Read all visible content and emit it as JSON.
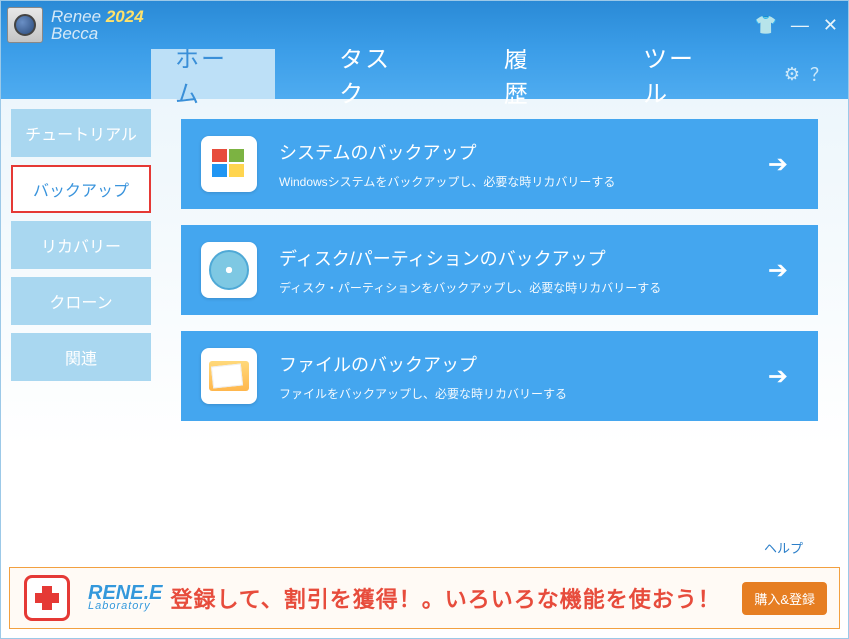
{
  "brand": {
    "name1": "Renee",
    "name2": "Becca",
    "year": "2024"
  },
  "title_controls": {
    "pin_icon": "pin-icon",
    "min_icon": "minimize-icon",
    "close_icon": "close-icon"
  },
  "nav": {
    "tabs": [
      {
        "label": "ホーム",
        "active": true
      },
      {
        "label": "タスク",
        "active": false
      },
      {
        "label": "履歴",
        "active": false
      },
      {
        "label": "ツール",
        "active": false
      }
    ],
    "settings_icon": "gear-icon",
    "help_icon": "question-icon"
  },
  "sidebar": {
    "items": [
      {
        "label": "チュートリアル",
        "highlighted": false
      },
      {
        "label": "バックアップ",
        "highlighted": true
      },
      {
        "label": "リカバリー",
        "highlighted": false
      },
      {
        "label": "クローン",
        "highlighted": false
      },
      {
        "label": "関連",
        "highlighted": false
      }
    ]
  },
  "cards": [
    {
      "icon": "windows-icon",
      "title": "システムのバックアップ",
      "desc": "Windowsシステムをバックアップし、必要な時リカバリーする"
    },
    {
      "icon": "disk-icon",
      "title": "ディスク/パーティションのバックアップ",
      "desc": "ディスク・パーティションをバックアップし、必要な時リカバリーする"
    },
    {
      "icon": "folder-icon",
      "title": "ファイルのバックアップ",
      "desc": "ファイルをバックアップし、必要な時リカバリーする"
    }
  ],
  "help_link": "ヘルプ",
  "promo": {
    "brand_line1": "RENE.E",
    "brand_line2": "Laboratory",
    "text": "登録して、割引を獲得！。いろいろな機能を使おう！",
    "button": "購入&登録"
  }
}
